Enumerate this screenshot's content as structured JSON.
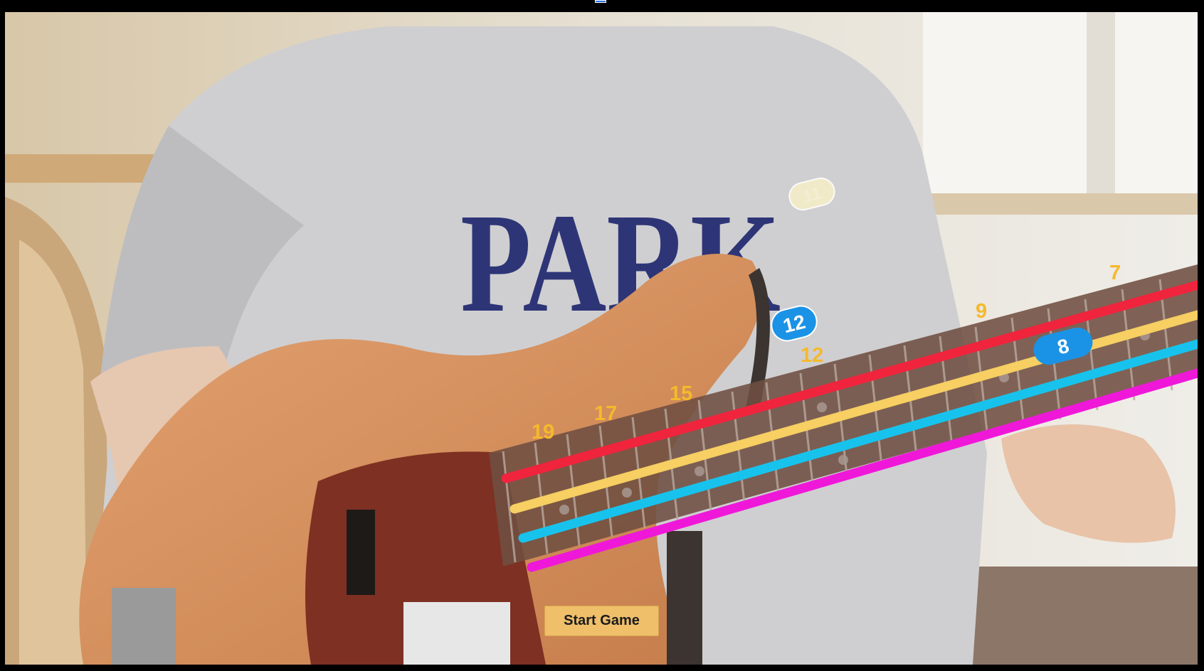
{
  "window": {
    "marker_color": "#2f6fe0"
  },
  "camera_feed": {
    "shirt_text": "PARK",
    "shirt_text_color": "#2e3577"
  },
  "fretboard": {
    "string_colors": [
      "#f0243c",
      "#f7cf62",
      "#17c3ec",
      "#ef18d9"
    ],
    "fret_labels": [
      "19",
      "17",
      "15",
      "12",
      "9",
      "7"
    ],
    "fret_label_color": "#f5b92c"
  },
  "notes": {
    "active": [
      "12",
      "8"
    ],
    "upcoming": "11",
    "active_color": "#1a93e6",
    "upcoming_color": "#f4eec8"
  },
  "controls": {
    "start_label": "Start Game"
  }
}
